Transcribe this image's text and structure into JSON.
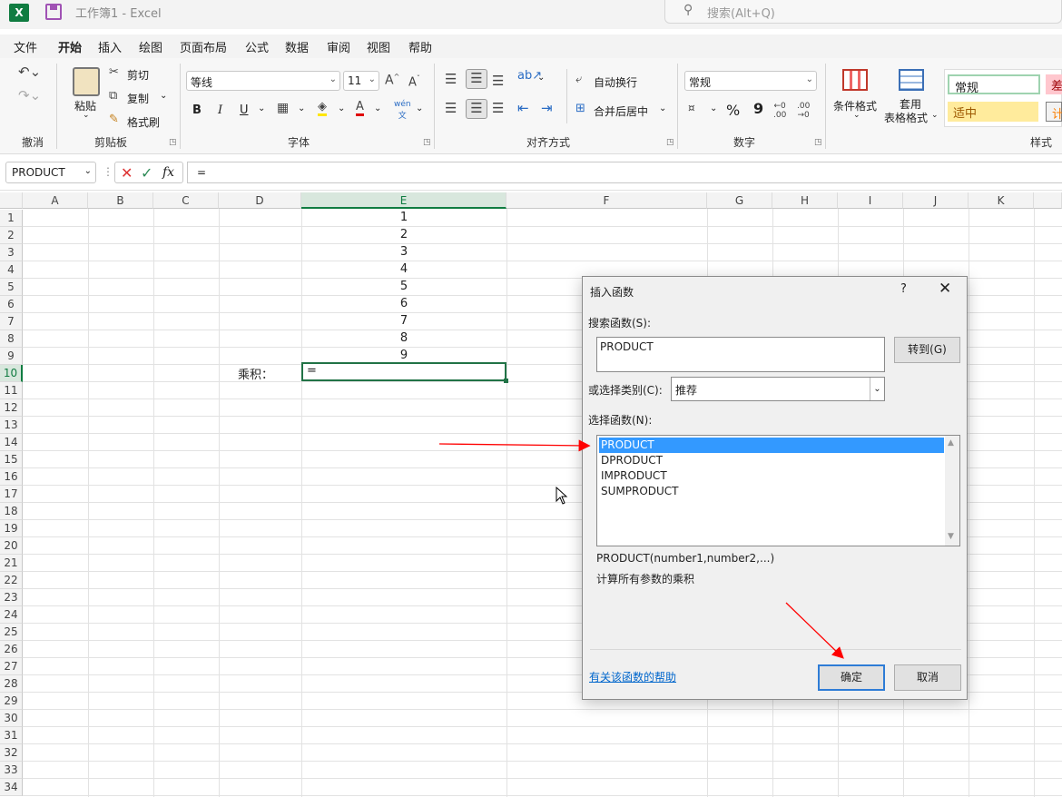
{
  "titlebar": {
    "logo_text": "X",
    "title": "工作簿1  -  Excel",
    "search_placeholder": "搜索(Alt+Q)"
  },
  "menu": [
    "文件",
    "开始",
    "插入",
    "绘图",
    "页面布局",
    "公式",
    "数据",
    "审阅",
    "视图",
    "帮助"
  ],
  "menu_active": "开始",
  "ribbon": {
    "undo_group": "撤消",
    "clipboard": {
      "paste": "粘贴",
      "cut": "剪切",
      "copy": "复制",
      "format_painter": "格式刷",
      "label": "剪贴板"
    },
    "font": {
      "name": "等线",
      "size": "11",
      "bold": "B",
      "italic": "I",
      "underline": "U",
      "label": "字体"
    },
    "alignment": {
      "wrap": "自动换行",
      "merge": "合并后居中",
      "label": "对齐方式"
    },
    "number": {
      "format": "常规",
      "percent": "%",
      "comma": "9",
      "label": "数字"
    },
    "styles": {
      "conditional": "条件格式",
      "table_l1": "套用",
      "table_l2": "表格格式",
      "normal": "常规",
      "bad": "差",
      "neutral": "适中",
      "calc": "计",
      "label": "样式"
    }
  },
  "formula_bar": {
    "name_box": "PRODUCT",
    "fx": "fx",
    "value": "="
  },
  "grid": {
    "columns": [
      "A",
      "B",
      "C",
      "D",
      "E",
      "F",
      "G",
      "H",
      "I",
      "J",
      "K"
    ],
    "selected_column": "E",
    "rows": [
      "1",
      "2",
      "3",
      "4",
      "5",
      "6",
      "7",
      "8",
      "9",
      "10",
      "11",
      "12",
      "13",
      "14",
      "15",
      "16",
      "17",
      "18",
      "19",
      "20",
      "21",
      "22",
      "23",
      "24",
      "25",
      "26",
      "27",
      "28",
      "29",
      "30",
      "31",
      "32",
      "33",
      "34"
    ],
    "selected_row": "10",
    "e_values": [
      "1",
      "2",
      "3",
      "4",
      "5",
      "6",
      "7",
      "8",
      "9"
    ],
    "d10_label": "乘积：",
    "active_cell_value": "="
  },
  "dialog": {
    "title": "插入函数",
    "help": "?",
    "close": "✕",
    "search_label": "搜索函数(S):",
    "search_value": "PRODUCT",
    "go_button": "转到(G)",
    "category_label": "或选择类别(C):",
    "category_value": "推荐",
    "select_label": "选择函数(N):",
    "functions": [
      "PRODUCT",
      "DPRODUCT",
      "IMPRODUCT",
      "SUMPRODUCT"
    ],
    "selected_function": "PRODUCT",
    "signature": "PRODUCT(number1,number2,...)",
    "description": "计算所有参数的乘积",
    "help_link": "有关该函数的帮助",
    "ok": "确定",
    "cancel": "取消"
  },
  "colors": {
    "excel_green": "#107c41",
    "selection_blue": "#3399ff",
    "arrow_red": "#ff0000"
  }
}
